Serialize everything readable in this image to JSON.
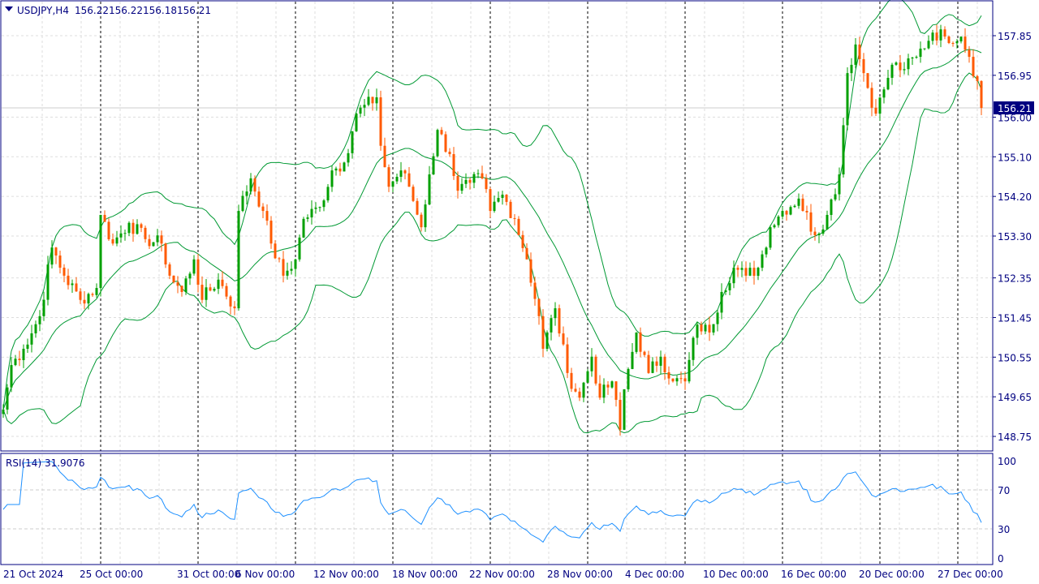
{
  "header": {
    "symbol": "USDJPY,H4",
    "open": "156.22",
    "high": "156.22",
    "low": "156.18",
    "close": "156.21"
  },
  "current_price": "156.21",
  "rsi_label": "RSI(14) 31.9076",
  "colors": {
    "frame": "#000080",
    "bull": "#00a000",
    "bear": "#ff5a00",
    "bands": "#009933",
    "rsi": "#1e90ff"
  },
  "chart_data": {
    "type": "candlestick",
    "title": "USDJPY,H4",
    "price_ticks": [
      "157.85",
      "156.95",
      "156.00",
      "155.10",
      "154.20",
      "153.30",
      "152.35",
      "151.45",
      "150.55",
      "149.65",
      "148.75"
    ],
    "ylim": [
      148.5,
      158.6
    ],
    "rsi_ticks": [
      "100",
      "70",
      "30",
      "0"
    ],
    "time_labels": [
      "21 Oct 2024",
      "25 Oct 00:00",
      "31 Oct 00:00",
      "6 Nov 00:00",
      "12 Nov 00:00",
      "18 Nov 00:00",
      "22 Nov 00:00",
      "28 Nov 00:00",
      "4 Dec 00:00",
      "10 Dec 00:00",
      "16 Dec 00:00",
      "20 Dec 00:00",
      "27 Dec 00:00"
    ],
    "close_keypoints": [
      [
        0,
        149.36
      ],
      [
        2,
        150.37
      ],
      [
        5,
        150.74
      ],
      [
        9,
        151.48
      ],
      [
        12,
        153.04
      ],
      [
        15,
        152.4
      ],
      [
        19,
        151.85
      ],
      [
        23,
        152.12
      ],
      [
        24,
        153.78
      ],
      [
        27,
        153.13
      ],
      [
        31,
        153.6
      ],
      [
        35,
        153.23
      ],
      [
        39,
        153.13
      ],
      [
        41,
        152.4
      ],
      [
        44,
        152.03
      ],
      [
        47,
        152.77
      ],
      [
        49,
        151.85
      ],
      [
        53,
        152.31
      ],
      [
        57,
        151.66
      ],
      [
        58,
        153.87
      ],
      [
        61,
        154.61
      ],
      [
        64,
        153.87
      ],
      [
        66,
        153.13
      ],
      [
        69,
        152.4
      ],
      [
        72,
        152.77
      ],
      [
        74,
        153.69
      ],
      [
        78,
        153.96
      ],
      [
        81,
        154.79
      ],
      [
        84,
        154.97
      ],
      [
        87,
        156.08
      ],
      [
        92,
        156.45
      ],
      [
        93,
        155.35
      ],
      [
        95,
        154.42
      ],
      [
        98,
        154.79
      ],
      [
        100,
        154.42
      ],
      [
        103,
        153.5
      ],
      [
        105,
        154.7
      ],
      [
        107,
        155.71
      ],
      [
        110,
        155.16
      ],
      [
        112,
        154.33
      ],
      [
        115,
        154.51
      ],
      [
        118,
        154.61
      ],
      [
        120,
        153.87
      ],
      [
        123,
        154.24
      ],
      [
        126,
        153.69
      ],
      [
        129,
        152.77
      ],
      [
        132,
        151.48
      ],
      [
        133,
        150.74
      ],
      [
        136,
        151.66
      ],
      [
        139,
        150.19
      ],
      [
        142,
        149.63
      ],
      [
        145,
        150.56
      ],
      [
        147,
        149.63
      ],
      [
        150,
        150.0
      ],
      [
        152,
        148.9
      ],
      [
        153,
        149.82
      ],
      [
        156,
        151.11
      ],
      [
        159,
        150.19
      ],
      [
        162,
        150.56
      ],
      [
        165,
        150.0
      ],
      [
        168,
        150.0
      ],
      [
        171,
        151.29
      ],
      [
        174,
        151.11
      ],
      [
        177,
        152.03
      ],
      [
        180,
        152.58
      ],
      [
        183,
        152.4
      ],
      [
        186,
        152.58
      ],
      [
        189,
        153.5
      ],
      [
        192,
        153.87
      ],
      [
        196,
        154.15
      ],
      [
        200,
        153.32
      ],
      [
        203,
        153.78
      ],
      [
        206,
        154.7
      ],
      [
        208,
        157.0
      ],
      [
        210,
        157.65
      ],
      [
        212,
        157.0
      ],
      [
        215,
        156.08
      ],
      [
        217,
        156.63
      ],
      [
        219,
        157.19
      ],
      [
        222,
        157.09
      ],
      [
        225,
        157.37
      ],
      [
        229,
        157.92
      ],
      [
        232,
        157.83
      ],
      [
        236,
        157.83
      ],
      [
        238,
        157.37
      ],
      [
        240,
        156.82
      ],
      [
        241,
        156.21
      ]
    ]
  }
}
